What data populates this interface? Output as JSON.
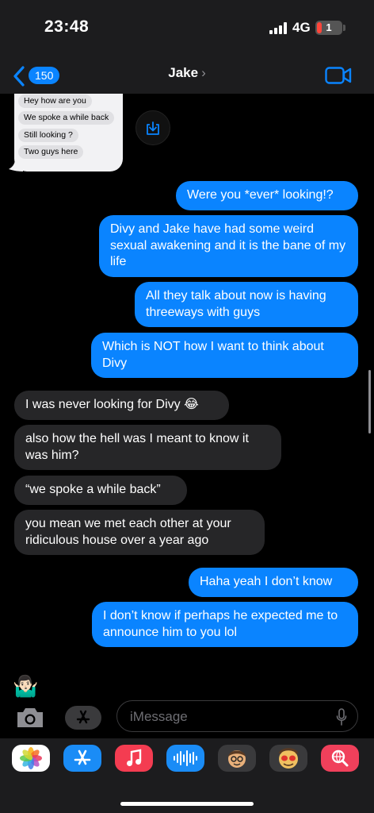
{
  "status_bar": {
    "time": "23:48",
    "network": "4G",
    "battery": "1"
  },
  "nav": {
    "back_count": "150",
    "contact_name": "Jake",
    "chevron": "›"
  },
  "screenshot_attachment": {
    "messages": [
      "Hey how are you",
      "We spoke a while back",
      "Still looking ?",
      "Two guys here"
    ]
  },
  "messages": [
    {
      "from": "me",
      "text": "Were you *ever* looking!?"
    },
    {
      "from": "me",
      "text": "Divy and Jake have had some weird sexual awakening and it is the bane of my life"
    },
    {
      "from": "me",
      "text": "All they talk about now is having threeways with guys"
    },
    {
      "from": "me",
      "text": "Which is NOT how I want to think about Divy"
    },
    {
      "from": "them",
      "text": "I was never looking for Divy 😂"
    },
    {
      "from": "them",
      "text": "also how the hell was I meant to know it was him?"
    },
    {
      "from": "them",
      "text": "“we spoke a while back”"
    },
    {
      "from": "them",
      "text": "you mean we met each other at your ridiculous house over a year ago"
    },
    {
      "from": "me",
      "text": "Haha yeah I don’t know"
    },
    {
      "from": "me",
      "text": "I don’t know if perhaps he expected me to announce him to you lol"
    }
  ],
  "memoji": "🤷🏻‍♂️",
  "input": {
    "placeholder": "iMessage"
  },
  "app_tray": {
    "apps": [
      "photos-app-icon",
      "app-store-icon",
      "music-icon",
      "audio-message-icon",
      "memoji-icon",
      "animoji-icon",
      "image-search-icon"
    ]
  },
  "colors": {
    "sent_bubble": "#0a84ff",
    "received_bubble": "#262628",
    "background": "#000000",
    "bar": "#1c1c1e"
  }
}
